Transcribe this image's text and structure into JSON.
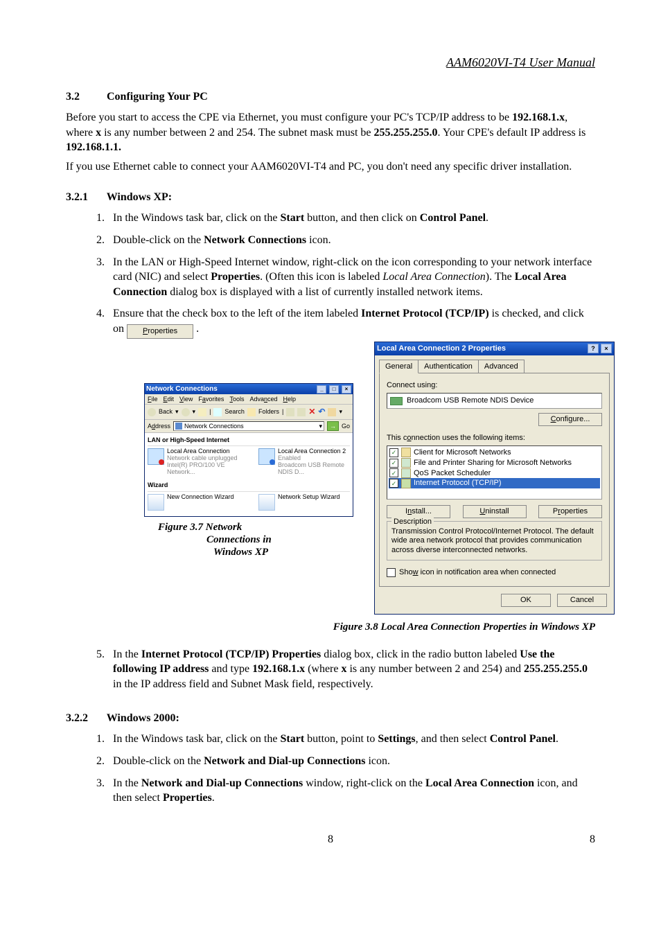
{
  "doc_header": "AAM6020VI-T4 User Manual",
  "section_3_2": {
    "num": "3.2",
    "title": "Configuring Your PC"
  },
  "intro": {
    "p1a": "Before you start to access the CPE via Ethernet, you must configure your PC's TCP/IP address to be ",
    "ip_pattern": "192.168.1.x",
    "p1b": ", where ",
    "x": "x",
    "p1c": " is any number between 2 and 254. The subnet mask must be ",
    "mask": "255.255.255.0",
    "p1d": ". Your CPE's default IP address is ",
    "default_ip": "192.168.1.1.",
    "p2": "If you use Ethernet cable to connect your AAM6020VI-T4 and PC, you don't need any specific driver installation."
  },
  "section_3_2_1": {
    "num": "3.2.1",
    "title": "Windows XP:"
  },
  "xp_steps": {
    "s1": {
      "pre": "In the Windows task bar, click on the ",
      "b1": "Start",
      "mid": " button, and then click on ",
      "b2": "Control Panel",
      "post": "."
    },
    "s2": {
      "pre": "Double-click on the ",
      "b1": "Network Connections",
      "post": " icon."
    },
    "s3": {
      "pre": "In the LAN or High-Speed Internet window, right-click on the icon corresponding to your network interface card (NIC) and select ",
      "b1": "Properties",
      "mid": ". (Often this icon is labeled ",
      "i1": "Local Area Connection",
      "mid2": "). The ",
      "b2": "Local Area Connection",
      "post": " dialog box is displayed with a list of currently installed network items."
    },
    "s4": {
      "pre": "Ensure that the check box to the left of the item labeled ",
      "b1": "Internet Protocol (TCP/IP)",
      "mid": " is checked, and click on ",
      "btn": "Properties",
      "post": " ."
    },
    "s5": {
      "pre": "In the ",
      "b1": "Internet Protocol (TCP/IP) Properties",
      "mid1": " dialog box, click in the radio button labeled ",
      "b2": "Use the following IP address",
      "mid2": " and type ",
      "b3": "192.168.1.x",
      "mid3": " (where ",
      "bx": "x",
      "mid4": " is any number between 2 and 254) and ",
      "b4": "255.255.255.0",
      "post": " in the IP address field and Subnet Mask field, respectively."
    }
  },
  "nc_window": {
    "title": "Network Connections",
    "menus": [
      "File",
      "Edit",
      "View",
      "Favorites",
      "Tools",
      "Advanced",
      "Help"
    ],
    "back": "Back",
    "search": "Search",
    "folders": "Folders",
    "address_label": "Address",
    "address_value": "Network Connections",
    "go": "Go",
    "group1": "LAN or High-Speed Internet",
    "conn1": {
      "name": "Local Area Connection",
      "status": "Network cable unplugged",
      "device": "Intel(R) PRO/100 VE Network..."
    },
    "conn2": {
      "name": "Local Area Connection 2",
      "status": "Enabled",
      "device": "Broadcom USB Remote NDIS D..."
    },
    "group2": "Wizard",
    "wiz1": "New Connection Wizard",
    "wiz2": "Network Setup Wizard"
  },
  "fig37": {
    "l1": "Figure 3.7 Network",
    "l2": "Connections in",
    "l3": "Windows XP"
  },
  "prop_dialog": {
    "title": "Local Area Connection 2 Properties",
    "tabs": [
      "General",
      "Authentication",
      "Advanced"
    ],
    "connect_using": "Connect using:",
    "device": "Broadcom USB Remote NDIS Device",
    "configure": "Configure...",
    "uses_following": "This connection uses the following items:",
    "items": [
      "Client for Microsoft Networks",
      "File and Printer Sharing for Microsoft Networks",
      "QoS Packet Scheduler",
      "Internet Protocol (TCP/IP)"
    ],
    "install": "Install...",
    "uninstall": "Uninstall",
    "properties": "Properties",
    "description_label": "Description",
    "description_text": "Transmission Control Protocol/Internet Protocol. The default wide area network protocol that provides communication across diverse interconnected networks.",
    "show_icon": "Show icon in notification area when connected",
    "ok": "OK",
    "cancel": "Cancel"
  },
  "fig38": "Figure 3.8 Local Area Connection Properties in Windows XP",
  "section_3_2_2": {
    "num": "3.2.2",
    "title": "Windows 2000:"
  },
  "w2k_steps": {
    "s1": {
      "pre": "In the Windows task bar, click on the ",
      "b1": "Start",
      "mid": " button, point to ",
      "b2": "Settings",
      "mid2": ", and then select ",
      "b3": "Control Panel",
      "post": "."
    },
    "s2": {
      "pre": "Double-click on the ",
      "b1": "Network and Dial-up Connections",
      "post": " icon."
    },
    "s3": {
      "pre": "In the ",
      "b1": "Network and Dial-up Connections",
      "mid": " window, right-click on the ",
      "b2": "Local Area Connection",
      "mid2": " icon, and then select ",
      "b3": "Properties",
      "post": "."
    }
  },
  "page_number": "8"
}
